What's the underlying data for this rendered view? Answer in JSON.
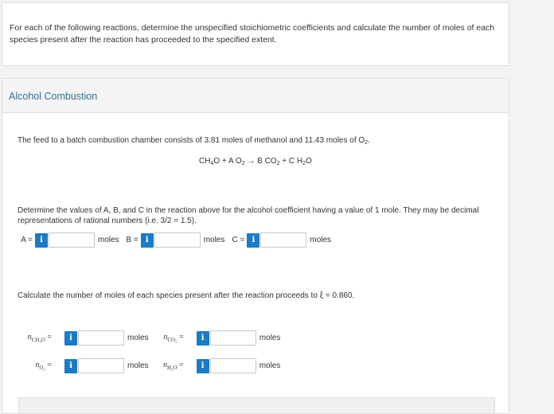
{
  "intro": {
    "text": "For each of the following reactions, determine the unspecified stoichiometric coefficients and calculate the number of moles of each species present after the reaction has proceeded to the specified extent."
  },
  "problem": {
    "title": "Alcohol Combustion",
    "feed_text_before": "The feed to a batch combustion chamber consists of 3.81 moles of methanol and 11.43 moles of O",
    "feed_sub": "2",
    "feed_after": ".",
    "equation": {
      "p1": "CH",
      "s1": "4",
      "p2": "O + A O",
      "s2": "2",
      "p3": " → B CO",
      "s3": "2",
      "p4": " + C H",
      "s4": "2",
      "p5": "O"
    },
    "coef_instructions": "Determine the values of A, B, and C in the reaction above for the alcohol coefficient having a value of 1 mole. They may be decimal representations of rational numbers (i.e. 3/2 = 1.5).",
    "coefficients": [
      {
        "label": "A =",
        "unit": "moles"
      },
      {
        "label": "B =",
        "unit": "moles"
      },
      {
        "label": "C =",
        "unit": "moles"
      }
    ],
    "extent_text": "Calculate the number of moles of each species present after the reaction proceeds to ξ = 0.860.",
    "species": [
      {
        "n": "n",
        "sub": "CH₄O",
        "eq": " =",
        "unit": "moles"
      },
      {
        "n": "n",
        "sub": "CO₂",
        "eq": " =",
        "unit": "moles"
      },
      {
        "n": "n",
        "sub": "O₂",
        "eq": " =",
        "unit": "moles"
      },
      {
        "n": "n",
        "sub": "H₂O",
        "eq": " =",
        "unit": "moles"
      }
    ],
    "info_glyph": "i"
  }
}
